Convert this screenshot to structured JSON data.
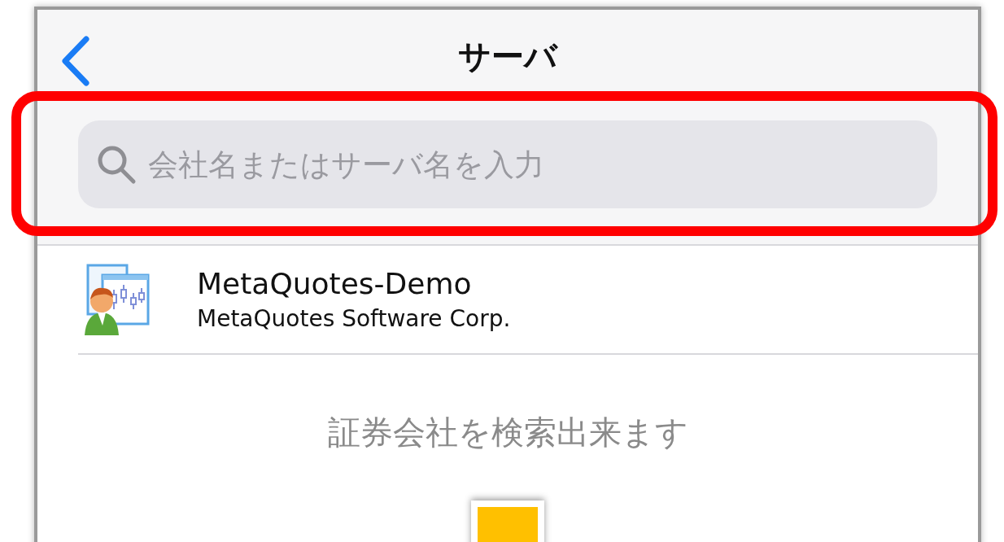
{
  "nav": {
    "title": "サーバ"
  },
  "search": {
    "placeholder": "会社名またはサーバ名を入力"
  },
  "servers": [
    {
      "name": "MetaQuotes-Demo",
      "company": "MetaQuotes Software Corp."
    }
  ],
  "message": "証券会社を検索出来ます"
}
